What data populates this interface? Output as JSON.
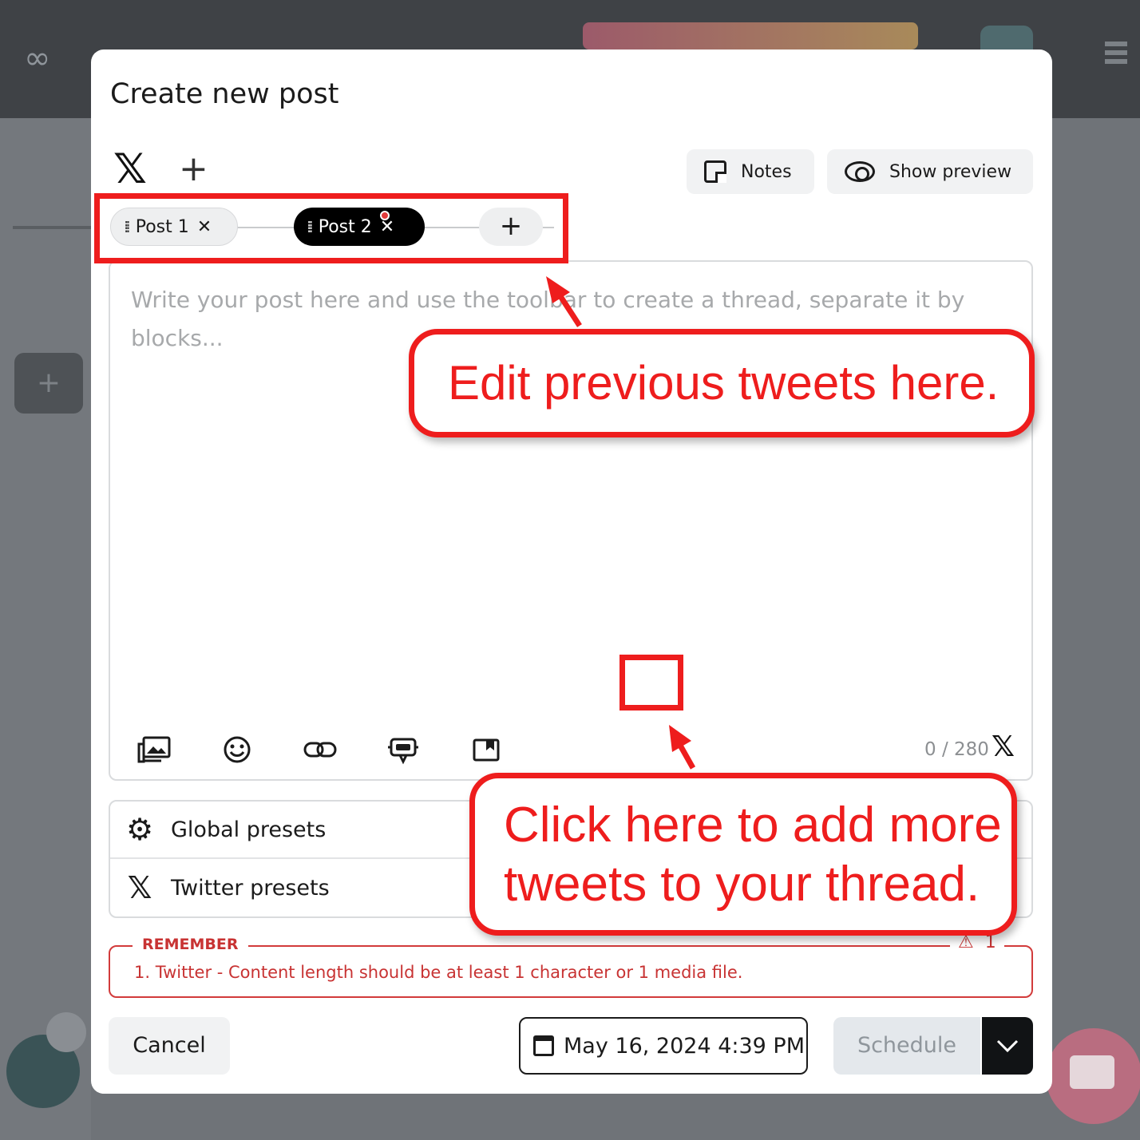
{
  "background": {
    "logo": "∞"
  },
  "modal": {
    "title": "Create new post",
    "network_icon": "x-logo",
    "add_network_label": "+",
    "notes_label": "Notes",
    "show_preview_label": "Show preview"
  },
  "thread_tabs": {
    "tabs": [
      {
        "label": "Post 1",
        "active": false
      },
      {
        "label": "Post 2",
        "active": true,
        "has_error_dot": true
      }
    ],
    "add_label": "+"
  },
  "editor": {
    "placeholder": "Write your post here and use the toolbar to create a thread, separate it by blocks...",
    "char_count": "0 / 280",
    "toolbar": {
      "add": "+",
      "prev": "←",
      "next": "→"
    },
    "tools": [
      "media-icon",
      "emoji-icon",
      "link-icon",
      "ai-bot-icon",
      "bookmark-icon"
    ]
  },
  "presets": {
    "global_label": "Global presets",
    "twitter_label": "Twitter presets"
  },
  "remember": {
    "label": "REMEMBER",
    "warning_count": "1",
    "message": "1. Twitter - Content length should be at least 1 character or 1 media file."
  },
  "footer": {
    "cancel_label": "Cancel",
    "date_label": "May 16, 2024 4:39 PM",
    "schedule_label": "Schedule"
  },
  "annotations": {
    "tabs_callout": "Edit previous tweets here.",
    "add_callout_line1": "Click here to add more",
    "add_callout_line2": "tweets to your thread."
  },
  "colors": {
    "annotation_red": "#ee1d1d",
    "warning_red": "#c83333",
    "active_tab": "#000000",
    "toolbar_bg": "#111315",
    "schedule_disabled": "#e4e8ec"
  }
}
